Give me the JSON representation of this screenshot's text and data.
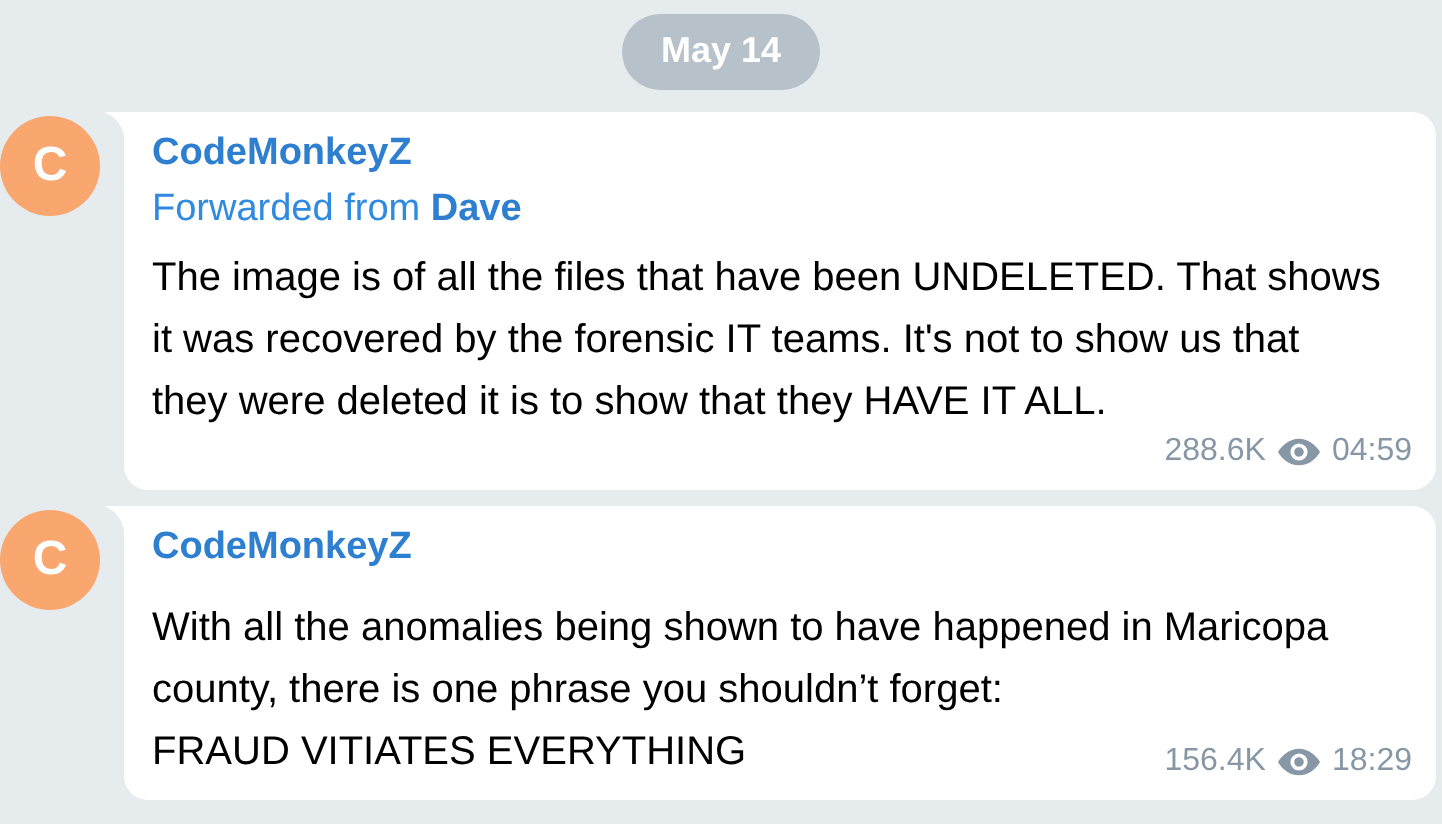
{
  "date_badge": "May 14",
  "messages": [
    {
      "avatar_letter": "C",
      "author": "CodeMonkeyZ",
      "forwarded": {
        "prefix": "Forwarded from",
        "name": "Dave"
      },
      "paragraphs": [
        "The image is of all the files that have been UNDELETED. That shows it was recovered by the forensic IT teams. It's not to show us that they were deleted it is to show that they HAVE IT ALL."
      ],
      "views": "288.6K",
      "time": "04:59"
    },
    {
      "avatar_letter": "C",
      "author": "CodeMonkeyZ",
      "paragraphs": [
        "With all the anomalies being shown to have happened in Maricopa county, there is one phrase you shouldn’t forget:",
        "FRAUD VITIATES EVERYTHING"
      ],
      "views": "156.4K",
      "time": "18:29"
    }
  ]
}
